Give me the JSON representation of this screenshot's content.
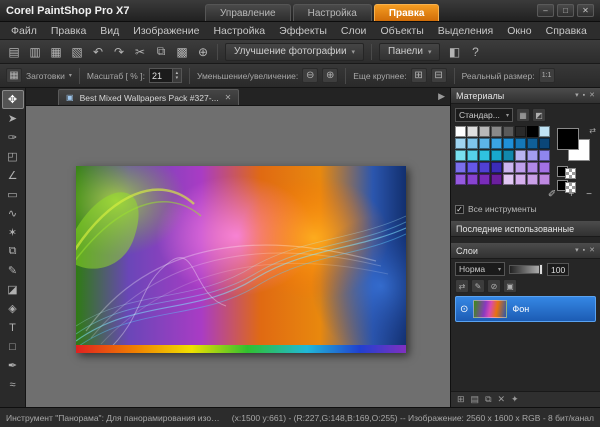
{
  "titlebar": {
    "app_title": "Corel PaintShop Pro X7",
    "tabs": [
      {
        "name": "tab-manage",
        "label": "Управление"
      },
      {
        "name": "tab-adjust",
        "label": "Настройка"
      },
      {
        "name": "tab-edit",
        "label": "Правка",
        "active": true
      }
    ],
    "window_buttons": [
      {
        "name": "minimize-button",
        "glyph": "–"
      },
      {
        "name": "maximize-button",
        "glyph": "□"
      },
      {
        "name": "close-button",
        "glyph": "✕"
      }
    ]
  },
  "menubar": {
    "items": [
      "Файл",
      "Правка",
      "Вид",
      "Изображение",
      "Настройка",
      "Эффекты",
      "Слои",
      "Объекты",
      "Выделения",
      "Окно",
      "Справка"
    ]
  },
  "toolbar": {
    "icons": [
      {
        "name": "new-file-icon",
        "glyph": "▤"
      },
      {
        "name": "open-file-icon",
        "glyph": "▥"
      },
      {
        "name": "save-icon",
        "glyph": "▦"
      },
      {
        "name": "print-icon",
        "glyph": "▧"
      },
      {
        "name": "undo-icon",
        "glyph": "↶"
      },
      {
        "name": "redo-icon",
        "glyph": "↷"
      },
      {
        "name": "cut-icon",
        "glyph": "✂"
      },
      {
        "name": "copy-icon",
        "glyph": "⧉"
      },
      {
        "name": "paste-icon",
        "glyph": "▩"
      },
      {
        "name": "zoom-icon",
        "glyph": "⊕"
      }
    ],
    "trailing_icons": [
      {
        "name": "screen-mode-icon",
        "glyph": "◧"
      },
      {
        "name": "help-icon",
        "glyph": "?"
      }
    ],
    "photo_fix_label": "Улучшение фотографии",
    "palettes_label": "Панели"
  },
  "options_bar": {
    "presets_icon": "▦",
    "presets_label": "Заготовки",
    "zoom_label": "Масштаб [ % ]:",
    "zoom_value": "21",
    "zoom_inout_label": "Уменьшение/увеличение:",
    "zoom_out_glyph": "⊖",
    "zoom_in_glyph": "⊕",
    "larger_label": "Еще крупнее:",
    "larger_glyph1": "⊞",
    "larger_glyph2": "⊟",
    "actual_size_label": "Реальный размер:",
    "actual_size_glyph": "1:1"
  },
  "tools": [
    {
      "name": "pan-tool",
      "glyph": "✥",
      "active": true
    },
    {
      "name": "pick-tool",
      "glyph": "➤"
    },
    {
      "name": "dropper-tool",
      "glyph": "✑"
    },
    {
      "name": "crop-tool",
      "glyph": "◰"
    },
    {
      "name": "straighten-tool",
      "glyph": "∠"
    },
    {
      "name": "selection-tool",
      "glyph": "▭"
    },
    {
      "name": "freehand-selection-tool",
      "glyph": "∿"
    },
    {
      "name": "magic-wand-tool",
      "glyph": "✶"
    },
    {
      "name": "clone-brush-tool",
      "glyph": "⧉"
    },
    {
      "name": "paint-brush-tool",
      "glyph": "✎"
    },
    {
      "name": "eraser-tool",
      "glyph": "◪"
    },
    {
      "name": "flood-fill-tool",
      "glyph": "◈"
    },
    {
      "name": "text-tool",
      "glyph": "T"
    },
    {
      "name": "preset-shape-tool",
      "glyph": "□"
    },
    {
      "name": "pen-tool",
      "glyph": "✒"
    },
    {
      "name": "warp-brush-tool",
      "glyph": "≈"
    }
  ],
  "document": {
    "tab_title": "Best Mixed Wallpapers Pack #327-...",
    "doc_icon": "▣",
    "close_glyph": "✕",
    "tab_scroll_glyph": "▶"
  },
  "materials": {
    "title": "Материалы",
    "header_icons": [
      {
        "name": "panel-menu-icon",
        "glyph": "▾"
      },
      {
        "name": "panel-pin-icon",
        "glyph": "▪"
      },
      {
        "name": "panel-close-icon",
        "glyph": "✕"
      }
    ],
    "dropdown_value": "Стандар...",
    "tab_buttons": [
      {
        "name": "swatches-view-icon",
        "glyph": "▦"
      },
      {
        "name": "rainbow-view-icon",
        "glyph": "◩"
      }
    ],
    "swatches": [
      "#ffffff",
      "#e0e0e0",
      "#b8b8b8",
      "#8a8a8a",
      "#5a5a5a",
      "#2a2a2a",
      "#000000",
      "#bfe3f5",
      "#9fd4f0",
      "#7ec5ec",
      "#5cb5e8",
      "#3aa5e4",
      "#1f90d8",
      "#1578b8",
      "#0f5f98",
      "#0a4678",
      "#79e0ef",
      "#55d2e8",
      "#2fc3e0",
      "#18a8cc",
      "#1288ac",
      "#b9b4f2",
      "#a49df0",
      "#8f86ee",
      "#7a6fec",
      "#6557e8",
      "#5040d4",
      "#3b2cb8",
      "#cdb6f0",
      "#bf9fec",
      "#b188e8",
      "#a371e4",
      "#955ae0",
      "#8743d0",
      "#792cba",
      "#6b1f9e",
      "#e2c8f4",
      "#d6b0ee",
      "#caa0e8",
      "#bd88e0"
    ],
    "foreground_color": "#000000",
    "background_color": "#ffffff",
    "swap_glyph": "⇄",
    "action_icons": [
      {
        "name": "eyedropper-icon",
        "glyph": "✐"
      },
      {
        "name": "add-swatch-icon",
        "glyph": "+"
      },
      {
        "name": "remove-swatch-icon",
        "glyph": "−"
      }
    ],
    "all_tools_label": "Все инструменты",
    "checkbox_glyph": "✓"
  },
  "recent": {
    "title": "Последние использованные"
  },
  "layers": {
    "title": "Слои",
    "header_icons": [
      {
        "name": "panel-menu-icon",
        "glyph": "▾"
      },
      {
        "name": "panel-pin-icon",
        "glyph": "▪"
      },
      {
        "name": "panel-close-icon",
        "glyph": "✕"
      }
    ],
    "blend_mode": "Норма",
    "opacity_value": "100",
    "toolbar_icons": [
      {
        "name": "link-layers-icon",
        "glyph": "⇄"
      },
      {
        "name": "edit-selection-icon",
        "glyph": "✎"
      },
      {
        "name": "lock-transparency-icon",
        "glyph": "⊘"
      },
      {
        "name": "highlight-layer-icon",
        "glyph": "▣"
      }
    ],
    "layer_name": "Фон",
    "eye_glyph": "⊙",
    "footer_icons": [
      {
        "name": "new-layer-icon",
        "glyph": "⊞"
      },
      {
        "name": "new-group-icon",
        "glyph": "▤"
      },
      {
        "name": "duplicate-layer-icon",
        "glyph": "⧉"
      },
      {
        "name": "delete-layer-icon",
        "glyph": "✕"
      },
      {
        "name": "layer-styles-icon",
        "glyph": "✦"
      }
    ]
  },
  "statusbar": {
    "left": "Инструмент \"Панорама\": Для панорамирования изображений размером больше окна щ...",
    "right": "(x:1500 y:661) - (R:227,G:148,B:169,O:255) -- Изображение:  2560 x 1600 x RGB - 8 бит/канал"
  },
  "colors": {
    "accent_orange": "#e8820c",
    "selection_blue": "#2a6fc8"
  }
}
